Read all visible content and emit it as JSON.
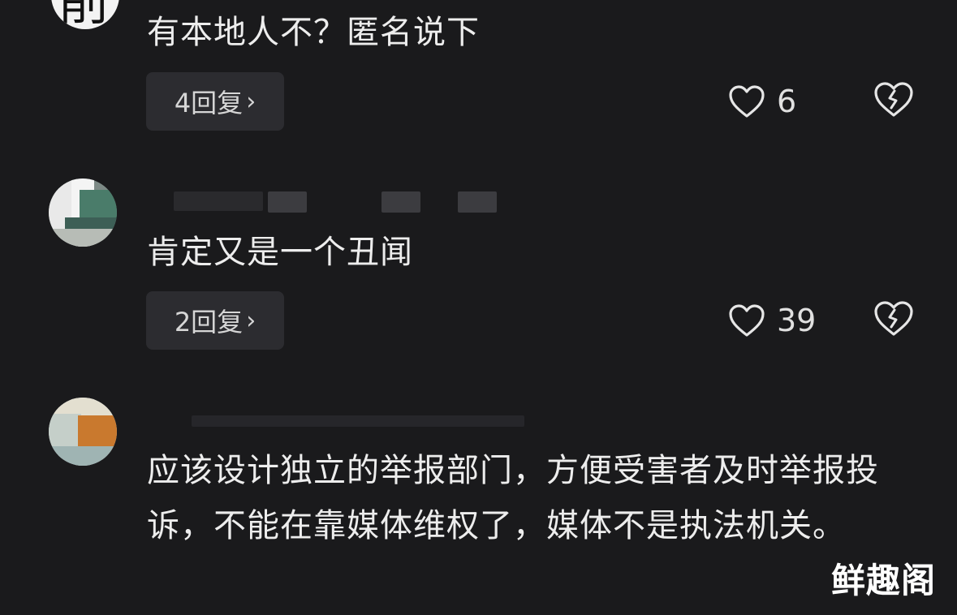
{
  "comments": [
    {
      "avatar_glyph": "削",
      "text": "有本地人不？匿名说下",
      "reply_label": "4回复",
      "likes": "6"
    },
    {
      "text": "肯定又是一个丑闻",
      "reply_label": "2回复",
      "likes": "39"
    },
    {
      "text": "应该设计独立的举报部门，方便受害者及时举报投诉，不能在靠媒体维权了，媒体不是执法机关。"
    }
  ],
  "icons": {
    "like": "heart-outline-icon",
    "dislike": "broken-heart-icon",
    "chevron": "chevron-right-icon"
  },
  "colors": {
    "background": "#1a1a1c",
    "text": "#ededed",
    "reply_button_bg": "#2c2c30"
  },
  "watermark": "鲜趣阁"
}
